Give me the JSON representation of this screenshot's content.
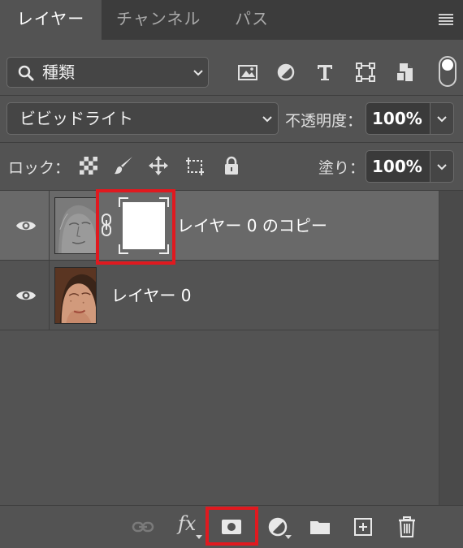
{
  "tabs": [
    {
      "label": "レイヤー",
      "active": true
    },
    {
      "label": "チャンネル",
      "active": false
    },
    {
      "label": "パス",
      "active": false
    }
  ],
  "filter": {
    "kind_label": "種類",
    "icons": [
      "image-filter-icon",
      "adjustment-filter-icon",
      "type-filter-icon",
      "shape-filter-icon",
      "smart-object-filter-icon"
    ]
  },
  "blend": {
    "mode": "ビビッドライト",
    "opacity_label": "不透明度：",
    "opacity_value": "100%",
    "lock_label": "ロック：",
    "fill_label": "塗り：",
    "fill_value": "100%"
  },
  "layers": [
    {
      "name": "レイヤー 0 のコピー",
      "selected": true,
      "visible": true,
      "has_mask": true
    },
    {
      "name": "レイヤー 0",
      "selected": false,
      "visible": true,
      "has_mask": false
    }
  ],
  "toolbar": {
    "fx_label": "fx"
  },
  "colors": {
    "highlight": "#e0191f",
    "panel_bg": "#535353",
    "selected_row": "#696969",
    "tab_bar": "#3c3c3c"
  }
}
